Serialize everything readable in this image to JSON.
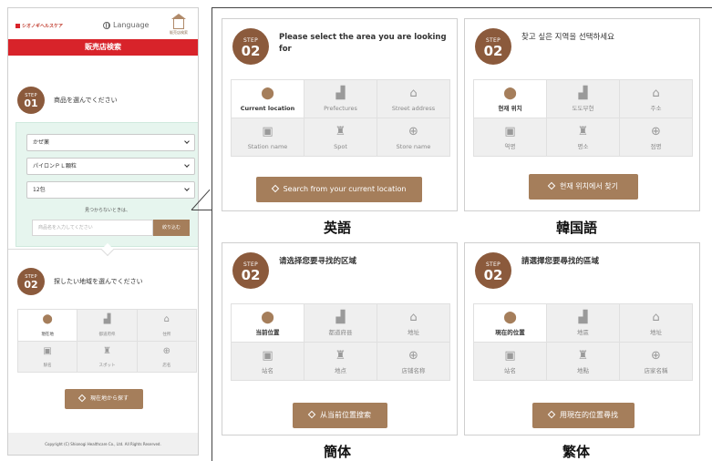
{
  "phone": {
    "logo": "シオノギヘルスケア",
    "language": "Language",
    "store_search_icon_label": "販売店検索",
    "title": "販売店検索",
    "step1": {
      "step": "STEP",
      "num": "01",
      "text": "商品を選んでください"
    },
    "selects": [
      "かぜ薬",
      "パイロンＰＬ顆粒",
      "12包"
    ],
    "not_found": "見つからないときは、",
    "input_placeholder": "商品名を入力してください",
    "narrow_button": "絞り込む",
    "step2": {
      "step": "STEP",
      "num": "02",
      "text": "探したい地域を選んでください"
    },
    "options": [
      {
        "label": "現在地",
        "icon": "pin-icon",
        "active": true
      },
      {
        "label": "都道府県",
        "icon": "stairs-icon"
      },
      {
        "label": "住所",
        "icon": "house-icon"
      },
      {
        "label": "駅名",
        "icon": "train-icon"
      },
      {
        "label": "スポット",
        "icon": "tower-icon"
      },
      {
        "label": "店名",
        "icon": "magnifier-icon"
      }
    ],
    "search_button": "現在地から探す",
    "footer": "Copyright (C) Shionogi Healthcare Co., Ltd. All Rights Reserved."
  },
  "cards": [
    {
      "step": "STEP",
      "num": "02",
      "question": "Please select the area you are looking for",
      "options": [
        "Current location",
        "Prefectures",
        "Street address",
        "Station name",
        "Spot",
        "Store name"
      ],
      "button": "Search from your current location",
      "caption": "英語"
    },
    {
      "step": "STEP",
      "num": "02",
      "question": "찾고 싶은 지역을 선택하세요",
      "options": [
        "현재 위치",
        "도도부현",
        "주소",
        "역명",
        "명소",
        "점명"
      ],
      "button": "현재 위치에서 찾기",
      "caption": "韓国語"
    },
    {
      "step": "STEP",
      "num": "02",
      "question": "请选择您要寻找的区域",
      "options": [
        "当前位置",
        "都道府县",
        "地址",
        "站名",
        "地点",
        "店铺名称"
      ],
      "button": "从当前位置搜索",
      "caption": "簡体"
    },
    {
      "step": "STEP",
      "num": "02",
      "question": "請選擇您要尋找的區域",
      "options": [
        "現在的位置",
        "地區",
        "地址",
        "站名",
        "地點",
        "店家名稱"
      ],
      "button": "用現在的位置尋找",
      "caption": "繁体"
    }
  ],
  "colors": {
    "brand_red": "#d8232a",
    "accent_brown": "#a57e5b",
    "badge_brown": "#8b5a3c",
    "panel_green": "#e6f5ee"
  }
}
